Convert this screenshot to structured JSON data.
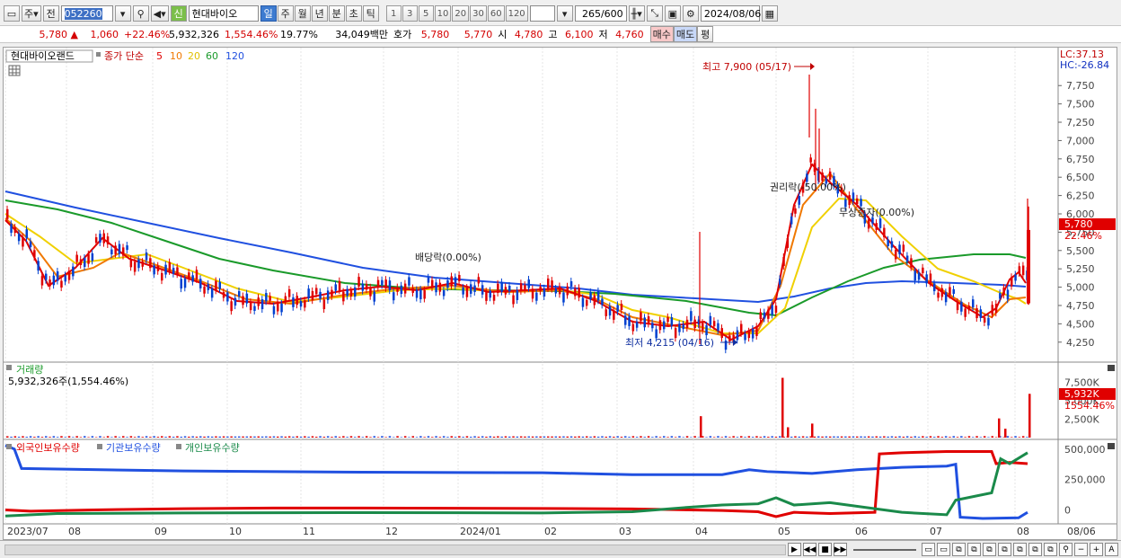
{
  "toolbar": {
    "type_label": "주",
    "prev_label": "전",
    "code": "052260",
    "signal_label": "신",
    "stock_name": "현대바이오",
    "periods": [
      "일",
      "주",
      "월",
      "년",
      "분",
      "초",
      "틱"
    ],
    "intervals": [
      "1",
      "3",
      "5",
      "10",
      "20",
      "30",
      "60",
      "120"
    ],
    "count": "265",
    "count_total": "/600",
    "date": "2024/08/06"
  },
  "quote": {
    "price": "5,780",
    "change": "1,060",
    "change_pct": "+22.46%",
    "volume": "5,932,326",
    "vol_ratio": "1,554.46%",
    "turnover": "19.77%",
    "amount": "34,049백만",
    "bid_label": "호가",
    "ask": "5,780",
    "bid": "5,770",
    "open_label": "시",
    "open": "4,780",
    "high_label": "고",
    "high": "6,100",
    "low_label": "저",
    "low": "4,760",
    "buy_label": "매수",
    "sell_label": "매도",
    "eval_label": "평"
  },
  "legend": {
    "name": "현대바이오랜드",
    "title": "종가 단순",
    "ma": [
      {
        "label": "5",
        "color": "#e00000"
      },
      {
        "label": "10",
        "color": "#f07800"
      },
      {
        "label": "20",
        "color": "#f0d000"
      },
      {
        "label": "60",
        "color": "#1a9a2a"
      },
      {
        "label": "120",
        "color": "#2050e0"
      }
    ]
  },
  "annotations": {
    "high": "최고 7,900 (05/17)",
    "low": "최저 4,215 (04/16)",
    "dividend": "배당락(0.00%)",
    "rights": "권리락(-50.00%)",
    "bonus": "무상증자(0.00%)"
  },
  "price_axis": {
    "lc": "LC:37.13",
    "hc": "HC:-26.84",
    "ticks": [
      "7,750",
      "7,500",
      "7,250",
      "7,000",
      "6,750",
      "6,500",
      "6,250",
      "6,000",
      "5,750",
      "5,500",
      "5,250",
      "5,000",
      "4,750",
      "4,500",
      "4,250"
    ],
    "cur_price": "5,780",
    "cur_pct": "22.46%"
  },
  "volume_panel": {
    "title": "거래량",
    "info": "5,932,326주(1,554.46%)",
    "ticks": [
      "7,500K",
      "5,000K",
      "2,500K"
    ],
    "cur": "5,932K",
    "cur_pct": "1554.46%"
  },
  "holders_panel": {
    "series": [
      {
        "name": "외국인보유수량",
        "color": "#e00000"
      },
      {
        "name": "기관보유수량",
        "color": "#2050e0"
      },
      {
        "name": "개인보유수량",
        "color": "#1a8a4a"
      }
    ],
    "ticks": [
      "500,000",
      "250,000",
      "0"
    ]
  },
  "x_axis": {
    "labels": [
      "2023/07",
      "08",
      "09",
      "10",
      "11",
      "12",
      "2024/01",
      "02",
      "03",
      "04",
      "05",
      "06",
      "07",
      "08",
      "08/06"
    ]
  },
  "chart_data": {
    "type": "line",
    "price_ylim": [
      4100,
      7900
    ],
    "high": 7900,
    "low": 4215,
    "last_close": 5780,
    "volume_ylim_k": [
      0,
      9500
    ],
    "last_volume_k": 5932,
    "holders_ylim": [
      -100000,
      550000
    ]
  }
}
